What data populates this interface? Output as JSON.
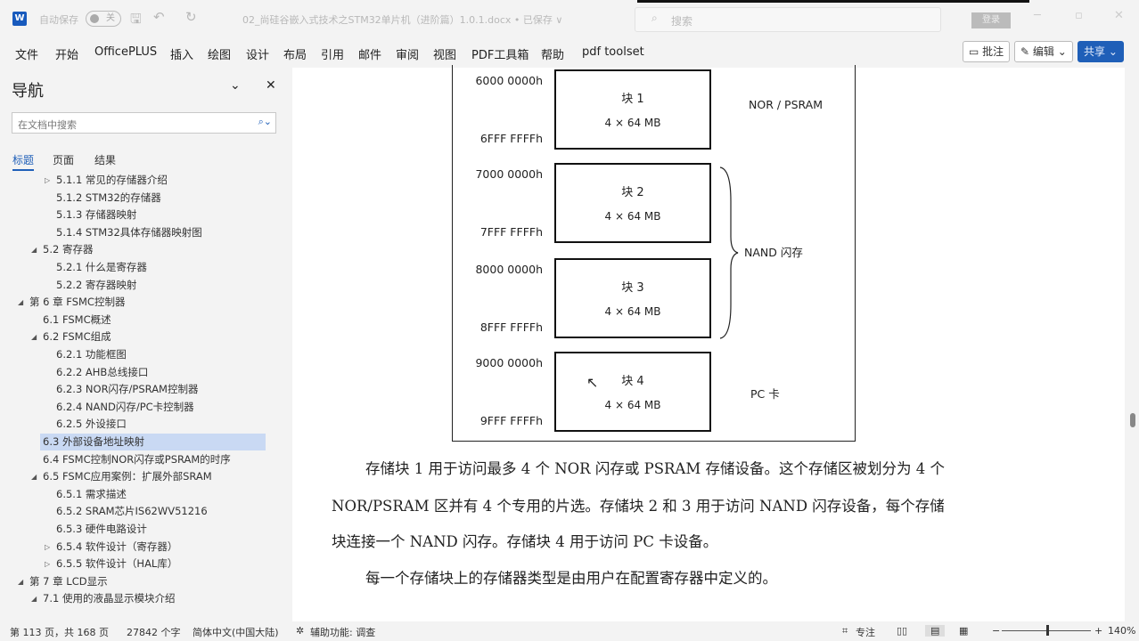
{
  "titlebar": {
    "autosave_label": "自动保存",
    "toggle_state": "关",
    "doc_title": "02_尚硅谷嵌入式技术之STM32单片机（进阶篇）1.0.1.docx • 已保存 ∨",
    "search_placeholder": "搜索",
    "login": "登录"
  },
  "ribbon": {
    "tabs": [
      "文件",
      "开始",
      "OfficePLUS",
      "插入",
      "绘图",
      "设计",
      "布局",
      "引用",
      "邮件",
      "审阅",
      "视图",
      "PDF工具箱",
      "帮助",
      "pdf toolset"
    ],
    "comment": "批注",
    "edit": "编辑",
    "share": "共享"
  },
  "nav": {
    "title": "导航",
    "search_placeholder": "在文档中搜索",
    "tabs": [
      "标题",
      "页面",
      "结果"
    ],
    "items": [
      {
        "label": "5.1.1 常见的存储器介绍",
        "level": 3,
        "arrow": "collapsed"
      },
      {
        "label": "5.1.2 STM32的存储器",
        "level": 3
      },
      {
        "label": "5.1.3 存储器映射",
        "level": 3
      },
      {
        "label": "5.1.4 STM32具体存储器映射图",
        "level": 3
      },
      {
        "label": "5.2 寄存器",
        "level": 2,
        "arrow": "expanded"
      },
      {
        "label": "5.2.1 什么是寄存器",
        "level": 3
      },
      {
        "label": "5.2.2 寄存器映射",
        "level": 3
      },
      {
        "label": "第 6 章 FSMC控制器",
        "level": 1,
        "arrow": "expanded"
      },
      {
        "label": "6.1 FSMC概述",
        "level": 2
      },
      {
        "label": "6.2 FSMC组成",
        "level": 2,
        "arrow": "expanded"
      },
      {
        "label": "6.2.1 功能框图",
        "level": 3
      },
      {
        "label": "6.2.2 AHB总线接口",
        "level": 3
      },
      {
        "label": "6.2.3 NOR闪存/PSRAM控制器",
        "level": 3
      },
      {
        "label": "6.2.4 NAND闪存/PC卡控制器",
        "level": 3
      },
      {
        "label": "6.2.5 外设接口",
        "level": 3
      },
      {
        "label": "6.3 外部设备地址映射",
        "level": 2,
        "selected": true
      },
      {
        "label": "6.4 FSMC控制NOR闪存或PSRAM的时序",
        "level": 2
      },
      {
        "label": "6.5 FSMC应用案例：扩展外部SRAM",
        "level": 2,
        "arrow": "expanded"
      },
      {
        "label": "6.5.1 需求描述",
        "level": 3
      },
      {
        "label": "6.5.2 SRAM芯片IS62WV51216",
        "level": 3
      },
      {
        "label": "6.5.3 硬件电路设计",
        "level": 3
      },
      {
        "label": "6.5.4 软件设计（寄存器）",
        "level": 3,
        "arrow": "collapsed"
      },
      {
        "label": "6.5.5 软件设计（HAL库）",
        "level": 3,
        "arrow": "collapsed"
      },
      {
        "label": "第 7 章 LCD显示",
        "level": 1,
        "arrow": "expanded"
      },
      {
        "label": "7.1 使用的液晶显示模块介绍",
        "level": 2,
        "arrow": "expanded"
      }
    ]
  },
  "diagram": {
    "blocks": [
      {
        "name": "块 1",
        "size": "4 × 64 MB",
        "start": "6000 0000h",
        "end": "6FFF FFFFh"
      },
      {
        "name": "块 2",
        "size": "4 × 64 MB",
        "start": "7000 0000h",
        "end": "7FFF FFFFh"
      },
      {
        "name": "块 3",
        "size": "4 × 64 MB",
        "start": "8000 0000h",
        "end": "8FFF FFFFh"
      },
      {
        "name": "块 4",
        "size": "4 × 64 MB",
        "start": "9000 0000h",
        "end": "9FFF FFFFh"
      }
    ],
    "labels": {
      "nor": "NOR / PSRAM",
      "nand": "NAND 闪存",
      "pc": "PC 卡"
    }
  },
  "body": {
    "lines": [
      "存储块 1 用于访问最多 4 个 NOR 闪存或 PSRAM 存储设备。这个存储区被划分为 4 个",
      "NOR/PSRAM 区并有 4 个专用的片选。存储块 2 和 3 用于访问 NAND 闪存设备，每个存储",
      "块连接一个 NAND 闪存。存储块 4 用于访问 PC 卡设备。",
      "每一个存储块上的存储器类型是由用户在配置寄存器中定义的。"
    ]
  },
  "status": {
    "page": "第 113 页，共 168 页",
    "words": "27842 个字",
    "lang": "简体中文(中国大陆)",
    "access": "辅助功能: 调查",
    "focus": "专注",
    "zoom": "140%"
  }
}
